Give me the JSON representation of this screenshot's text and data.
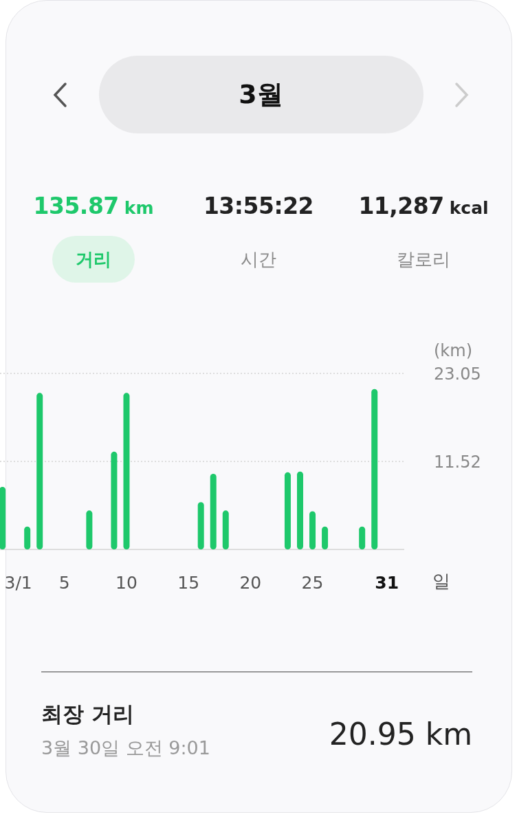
{
  "header": {
    "prev_disabled": false,
    "title": "3월",
    "next_disabled": true
  },
  "stats": [
    {
      "value": "135.87",
      "unit": "km",
      "selected": true
    },
    {
      "value": "13:55:22",
      "selected": false
    },
    {
      "value": "11,287",
      "unit": "kcal",
      "selected": false
    }
  ],
  "tabs": [
    {
      "label": "거리",
      "selected": true
    },
    {
      "label": "시간",
      "selected": false
    },
    {
      "label": "칼로리",
      "selected": false
    }
  ],
  "chart_data": {
    "type": "bar",
    "ylabel": "(km)",
    "xlabel": "일",
    "x": [
      0,
      2,
      3,
      7,
      9,
      10,
      16,
      17,
      18,
      23,
      24,
      25,
      26,
      29,
      30
    ],
    "series": [
      {
        "color": "#1ec86b",
        "values": [
          8.2,
          3.0,
          20.5,
          5.1,
          12.8,
          20.5,
          6.2,
          9.9,
          5.1,
          10.1,
          10.2,
          5.0,
          3.0,
          3.0,
          21.0
        ]
      }
    ],
    "xlim": [
      -0.2,
      32.4
    ],
    "ylim": [
      0,
      23.05
    ],
    "yticks": [
      11.52,
      23.05
    ],
    "xticks": [
      {
        "value": 1,
        "label": "3/1"
      },
      5,
      10,
      15,
      20,
      25,
      {
        "value": 31,
        "label": "31"
      }
    ]
  },
  "record": {
    "title": "최장 거리",
    "date": "3월 30일 오전 9:01",
    "value": "20.95 km"
  }
}
